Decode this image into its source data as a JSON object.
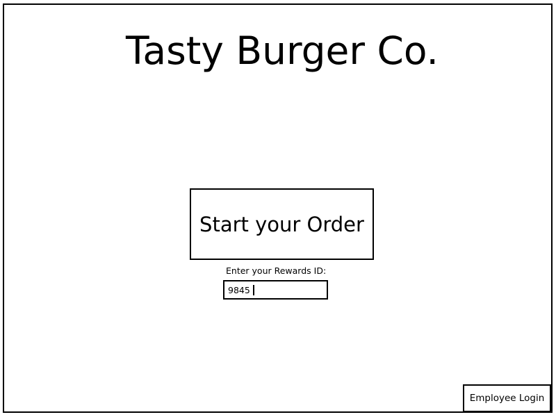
{
  "header": {
    "title": "Tasty Burger Co."
  },
  "main": {
    "start_button_label": "Start your Order",
    "rewards": {
      "label": "Enter your Rewards ID:",
      "value": "9845"
    }
  },
  "footer": {
    "employee_login_label": "Employee Login"
  },
  "colors": {
    "background": "#ffffff",
    "border": "#000000",
    "text": "#000000"
  }
}
